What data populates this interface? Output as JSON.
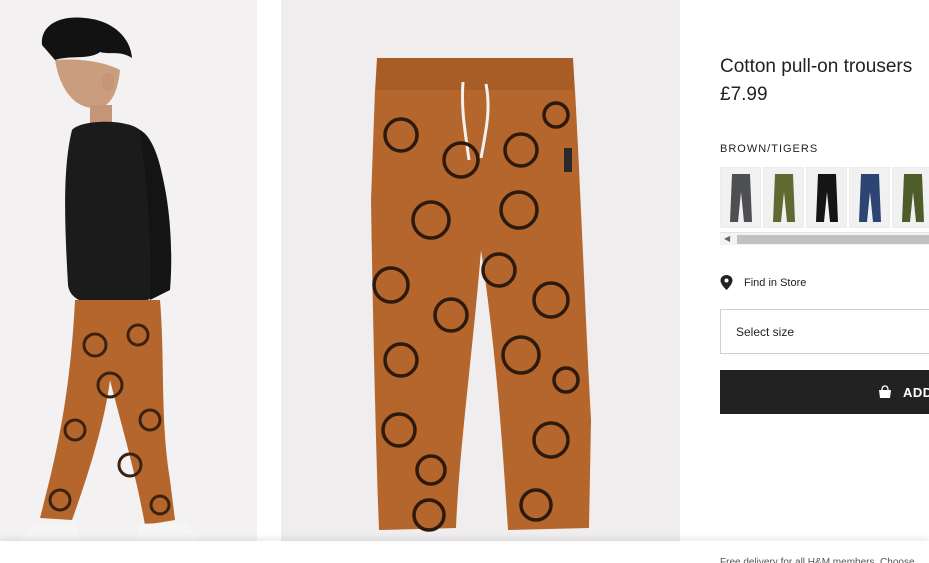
{
  "product": {
    "title": "Cotton pull-on trousers",
    "price": "£7.99",
    "color_name": "BROWN/TIGERS"
  },
  "swatches": [
    {
      "name": "dark grey",
      "color": "#4d4f52"
    },
    {
      "name": "khaki green",
      "color": "#5f6a33"
    },
    {
      "name": "black",
      "color": "#151515"
    },
    {
      "name": "dark blue",
      "color": "#2d4572"
    },
    {
      "name": "dark green",
      "color": "#4e5c2a"
    }
  ],
  "actions": {
    "find_in_store": "Find in Store",
    "select_size": "Select size",
    "add_label": "ADD"
  },
  "footer": {
    "delivery_text": "Free delivery for all H&M members. Choose"
  },
  "colors": {
    "accent_button": "#222222",
    "product_brown": "#b4662c"
  }
}
